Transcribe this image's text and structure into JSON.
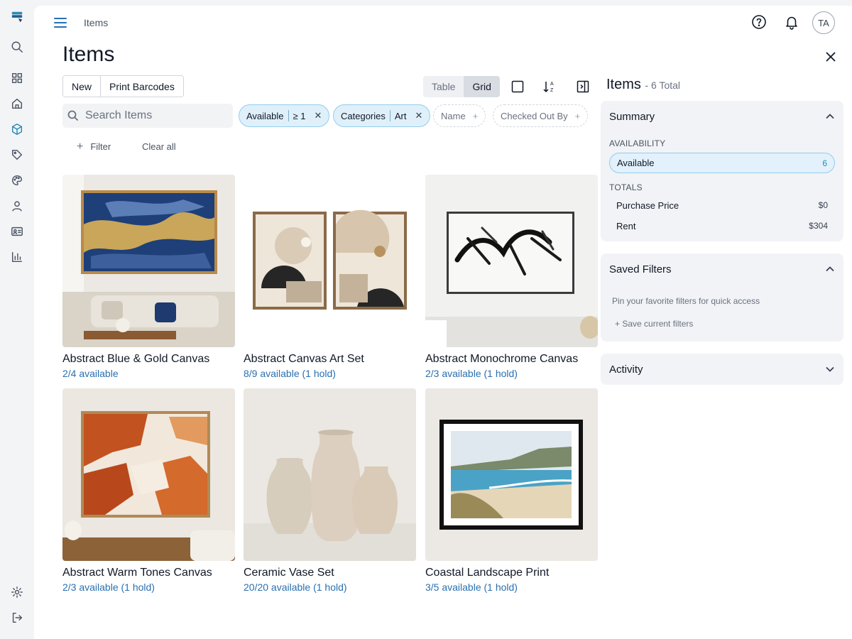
{
  "header": {
    "breadcrumb": "Items",
    "page_title": "Items",
    "avatar_initials": "TA"
  },
  "toolbar": {
    "new_label": "New",
    "print_label": "Print Barcodes",
    "view_options": [
      "Table",
      "Grid"
    ],
    "active_view": "Grid"
  },
  "search": {
    "placeholder": "Search Items",
    "value": ""
  },
  "filters": {
    "chips": [
      {
        "field": "Available",
        "value": "≥ 1",
        "active": true
      },
      {
        "field": "Categories",
        "value": "Art",
        "active": true
      },
      {
        "field": "Name",
        "active": false
      },
      {
        "field": "Checked Out By",
        "active": false
      }
    ],
    "add_filter_label": "Filter",
    "clear_label": "Clear all"
  },
  "items": [
    {
      "name": "Abstract Blue & Gold Canvas",
      "availability": "2/4 available"
    },
    {
      "name": "Abstract Canvas Art Set",
      "availability": "8/9 available (1 hold)"
    },
    {
      "name": "Abstract Monochrome Canvas",
      "availability": "2/3 available (1 hold)"
    },
    {
      "name": "Abstract Warm Tones Canvas",
      "availability": "2/3 available (1 hold)"
    },
    {
      "name": "Ceramic Vase Set",
      "availability": "20/20 available (1 hold)"
    },
    {
      "name": "Coastal Landscape Print",
      "availability": "3/5 available (1 hold)"
    }
  ],
  "sidebar": {
    "title": "Items",
    "total_label": "- 6 Total",
    "summary": {
      "heading": "Summary",
      "availability_label": "AVAILABILITY",
      "available_name": "Available",
      "available_count": "6",
      "totals_label": "TOTALS",
      "totals": [
        {
          "name": "Purchase Price",
          "value": "$0"
        },
        {
          "name": "Rent",
          "value": "$304"
        }
      ]
    },
    "saved_filters": {
      "heading": "Saved Filters",
      "hint": "Pin your favorite filters for quick access",
      "save_label": "+ Save current filters"
    },
    "activity": {
      "heading": "Activity"
    }
  },
  "colors": {
    "accent": "#2a8ab8",
    "link": "#2a6fb0",
    "chip_bg": "#dff0fb"
  }
}
